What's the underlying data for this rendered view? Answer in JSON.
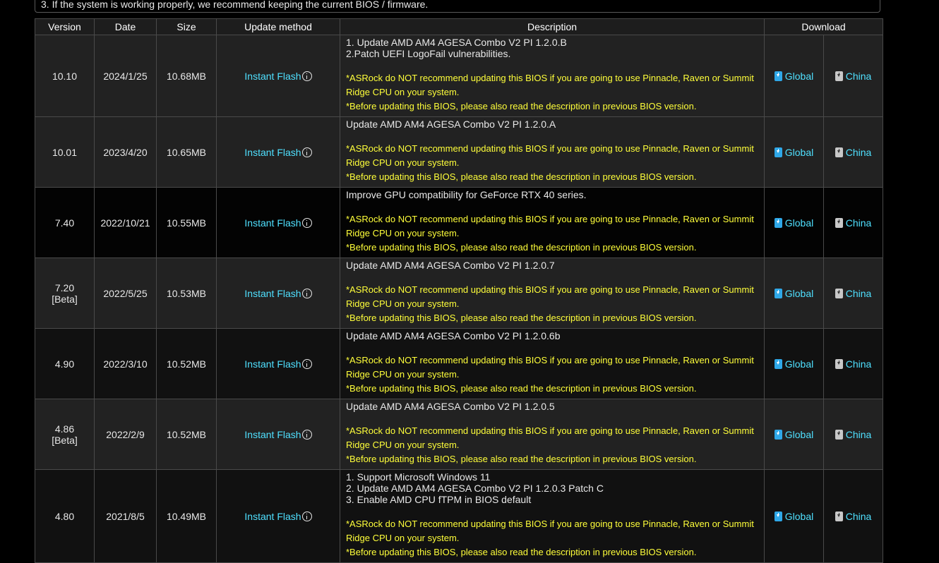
{
  "note": "3. If the system is working properly, we recommend keeping the current BIOS / firmware.",
  "headers": {
    "version": "Version",
    "date": "Date",
    "size": "Size",
    "update_method": "Update method",
    "description": "Description",
    "download": "Download"
  },
  "link_labels": {
    "instant_flash": "Instant Flash",
    "global": "Global",
    "china": "China"
  },
  "warnings": {
    "w1": "*ASRock do NOT recommend updating this BIOS if you are going to use Pinnacle, Raven or Summit Ridge CPU on your system.",
    "w2": "*Before updating this BIOS, please also read the description in previous BIOS version."
  },
  "rows": [
    {
      "version": "10.10",
      "date": "2024/1/25",
      "size": "10.68MB",
      "desc": [
        "1. Update AMD AM4 AGESA Combo V2 PI 1.2.0.B",
        "2.Patch UEFI LogoFail vulnerabilities."
      ]
    },
    {
      "version": "10.01",
      "date": "2023/4/20",
      "size": "10.65MB",
      "desc": [
        "Update AMD AM4 AGESA Combo V2 PI 1.2.0.A"
      ]
    },
    {
      "version": "7.40",
      "date": "2022/10/21",
      "size": "10.55MB",
      "desc": [
        "Improve GPU compatibility for GeForce RTX 40 series."
      ]
    },
    {
      "version": "7.20",
      "beta": "[Beta]",
      "date": "2022/5/25",
      "size": "10.53MB",
      "desc": [
        "Update AMD AM4 AGESA Combo V2 PI 1.2.0.7"
      ]
    },
    {
      "version": "4.90",
      "date": "2022/3/10",
      "size": "10.52MB",
      "desc": [
        "Update AMD AM4 AGESA Combo V2 PI 1.2.0.6b"
      ]
    },
    {
      "version": "4.86",
      "beta": "[Beta]",
      "date": "2022/2/9",
      "size": "10.52MB",
      "desc": [
        "Update AMD AM4 AGESA Combo V2 PI 1.2.0.5"
      ]
    },
    {
      "version": "4.80",
      "date": "2021/8/5",
      "size": "10.49MB",
      "desc": [
        "1. Support Microsoft Windows 11",
        "2. Update AMD AM4 AGESA Combo V2 PI 1.2.0.3 Patch C",
        "3. Enable AMD CPU fTPM in BIOS default"
      ]
    }
  ],
  "icons": {
    "info": "info-circle-icon",
    "global_download": "download-file-icon",
    "china_download": "download-file-icon"
  },
  "colors": {
    "link": "#4fe0ff",
    "warning": "#ffff3a",
    "global_icon": "#2fa8e8",
    "china_icon": "#c8c8c8"
  }
}
